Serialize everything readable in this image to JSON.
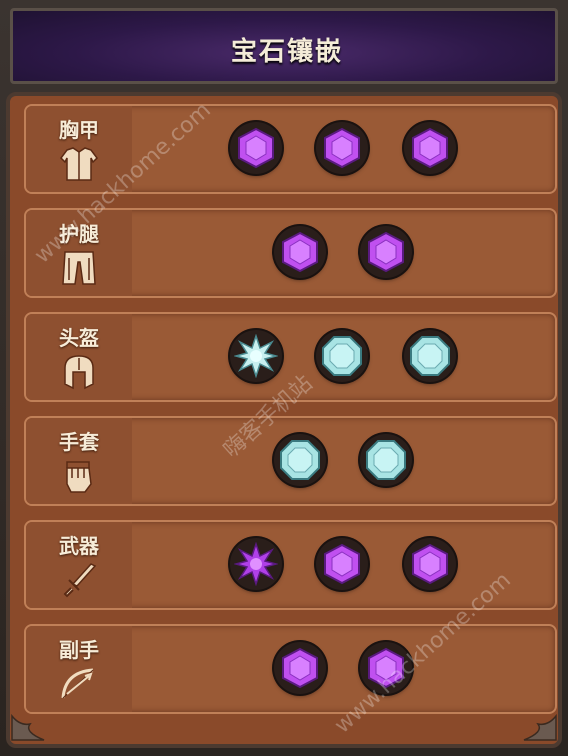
{
  "title": "宝石镶嵌",
  "slots": [
    {
      "label": "胸甲",
      "icon": "armor-chest-icon",
      "gems": [
        "purple-hexagon",
        "purple-hexagon",
        "purple-hexagon"
      ]
    },
    {
      "label": "护腿",
      "icon": "leg-armor-icon",
      "gems": [
        "purple-hexagon",
        "purple-hexagon"
      ]
    },
    {
      "label": "头盔",
      "icon": "helmet-icon",
      "gems": [
        "cyan-star",
        "cyan-octagon",
        "cyan-octagon"
      ]
    },
    {
      "label": "手套",
      "icon": "gauntlet-icon",
      "gems": [
        "cyan-octagon",
        "cyan-octagon"
      ]
    },
    {
      "label": "武器",
      "icon": "sword-icon",
      "gems": [
        "purple-star",
        "purple-hexagon",
        "purple-hexagon"
      ]
    },
    {
      "label": "副手",
      "icon": "bow-icon",
      "gems": [
        "purple-hexagon",
        "purple-hexagon"
      ]
    }
  ],
  "watermarks": {
    "site_top": "www.hackhome.com",
    "site_bottom": "www.hackhome.com",
    "cn": "嗨客手机站"
  },
  "colors": {
    "purple": "#b040e8",
    "cyan": "#a8e4e4",
    "panel": "#8a4a2a",
    "header": "#2d1848"
  }
}
